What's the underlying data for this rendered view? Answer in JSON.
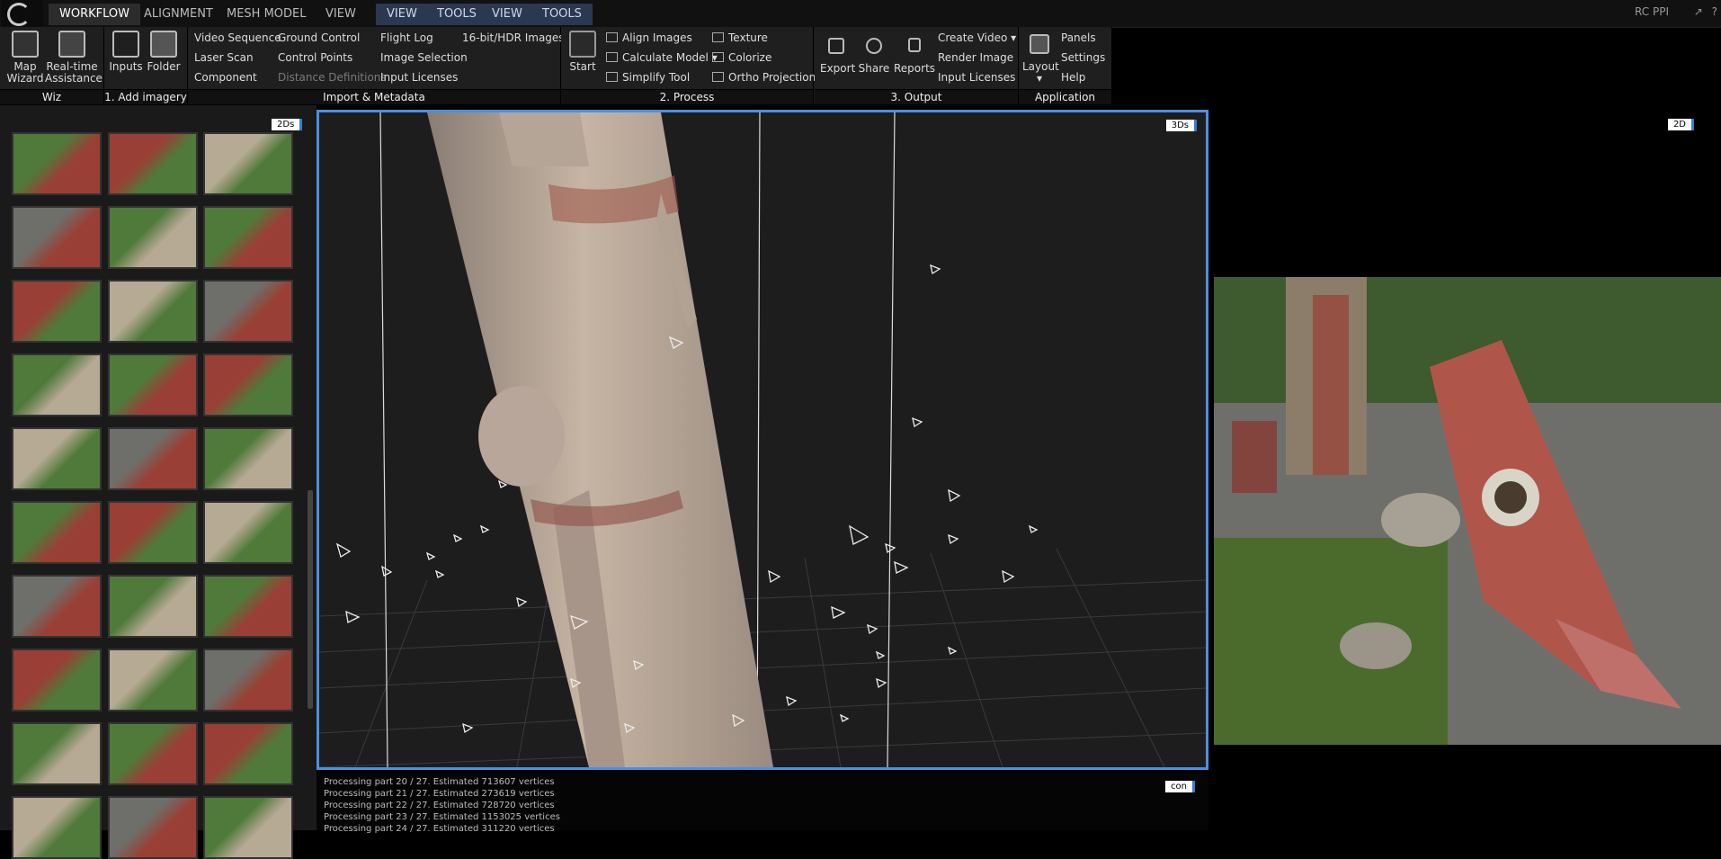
{
  "top_tabs": [
    {
      "label": "WORKFLOW",
      "state": "active"
    },
    {
      "label": "ALIGNMENT",
      "state": "normal"
    },
    {
      "label": "MESH MODEL",
      "state": "normal"
    },
    {
      "label": "VIEW",
      "state": "normal"
    },
    {
      "label": "VIEW",
      "state": "context"
    },
    {
      "label": "TOOLS",
      "state": "context"
    },
    {
      "label": "VIEW",
      "state": "context"
    },
    {
      "label": "TOOLS",
      "state": "context"
    }
  ],
  "user_label": "RC PPI",
  "ribbon": {
    "wiz": {
      "label": "Wiz",
      "map_wizard": "Map Wizard",
      "realtime": "Real-time Assistance"
    },
    "add_imagery": {
      "label": "1. Add imagery",
      "inputs": "Inputs",
      "folder": "Folder"
    },
    "import": {
      "label": "Import & Metadata",
      "col1": [
        "Video Sequence",
        "Laser Scan",
        "Component"
      ],
      "col2": [
        "Ground Control",
        "Control Points",
        "Distance Definitions"
      ],
      "col3": [
        "Flight Log",
        "Image Selection",
        "Input Licenses"
      ],
      "col4": [
        "16-bit/HDR Images"
      ]
    },
    "process": {
      "label": "2. Process",
      "start": "Start",
      "col1": [
        "Align Images",
        "Calculate Model",
        "Simplify Tool"
      ],
      "col2": [
        "Texture",
        "Colorize",
        "Ortho Projection"
      ]
    },
    "output": {
      "label": "3. Output",
      "export": "Export",
      "share": "Share",
      "reports": "Reports",
      "col": [
        "Create Video",
        "Render Image",
        "Input Licenses"
      ]
    },
    "application": {
      "label": "Application",
      "layout": "Layout",
      "col": [
        "Panels",
        "Settings",
        "Help"
      ]
    }
  },
  "views": {
    "left_tag": "2Ds",
    "center_tag": "3Ds",
    "right_tag": "2D",
    "console_tag": "con"
  },
  "console_lines": [
    "Processing part 20 / 27. Estimated 713607 vertices",
    "Processing part 21 / 27. Estimated 273619 vertices",
    "Processing part 22 / 27. Estimated 728720 vertices",
    "Processing part 23 / 27. Estimated 1153025 vertices",
    "Processing part 24 / 27. Estimated 311220 vertices"
  ],
  "thumb_palette": {
    "greenery": "#4f7a3a",
    "wood_red": "#9a3f35",
    "wood_light": "#b7aa95",
    "gravel": "#6e6f6a"
  }
}
